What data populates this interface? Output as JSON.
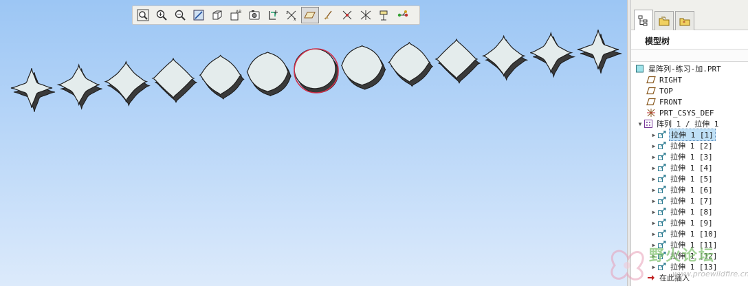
{
  "toolbar": {
    "buttons": [
      {
        "name": "refit-icon"
      },
      {
        "name": "zoom-in-icon"
      },
      {
        "name": "zoom-out-icon"
      },
      {
        "name": "repaint-icon"
      },
      {
        "name": "display-style-icon"
      },
      {
        "name": "saved-views-icon",
        "text": "AB"
      },
      {
        "name": "view-manager-icon"
      },
      {
        "name": "spin-center-icon"
      },
      {
        "name": "datum-planes-icon"
      },
      {
        "name": "datum-axes-icon"
      },
      {
        "name": "point-display-icon"
      },
      {
        "name": "csys-display-icon"
      },
      {
        "name": "annotation-display-icon"
      },
      {
        "name": "datum-point-tag-icon"
      },
      {
        "name": "model-tree-icon"
      }
    ]
  },
  "panel": {
    "title": "模型树",
    "tabs": [
      "model-tree-tab",
      "folder-tab",
      "favorites-tab"
    ]
  },
  "tree": {
    "root": "星阵列-练习-加.PRT",
    "datums": [
      {
        "label": "RIGHT",
        "icon": "datum-plane-icon"
      },
      {
        "label": "TOP",
        "icon": "datum-plane-icon"
      },
      {
        "label": "FRONT",
        "icon": "datum-plane-icon"
      },
      {
        "label": "PRT_CSYS_DEF",
        "icon": "csys-icon"
      }
    ],
    "pattern": "阵列 1 / 拉伸 1",
    "members": [
      "拉伸 1 [1]",
      "拉伸 1 [2]",
      "拉伸 1 [3]",
      "拉伸 1 [4]",
      "拉伸 1 [5]",
      "拉伸 1 [6]",
      "拉伸 1 [7]",
      "拉伸 1 [8]",
      "拉伸 1 [9]",
      "拉伸 1 [10]",
      "拉伸 1 [11]",
      "拉伸 1 [12]",
      "拉伸 1 [13]"
    ],
    "insert_here": "在此插入"
  },
  "watermark": {
    "text": "野火论坛",
    "url": "www.proewildfire.cn"
  },
  "colors": {
    "accent": "#d0304a",
    "selection": "#bfe0f6",
    "shape_face": "#e4ecec"
  }
}
